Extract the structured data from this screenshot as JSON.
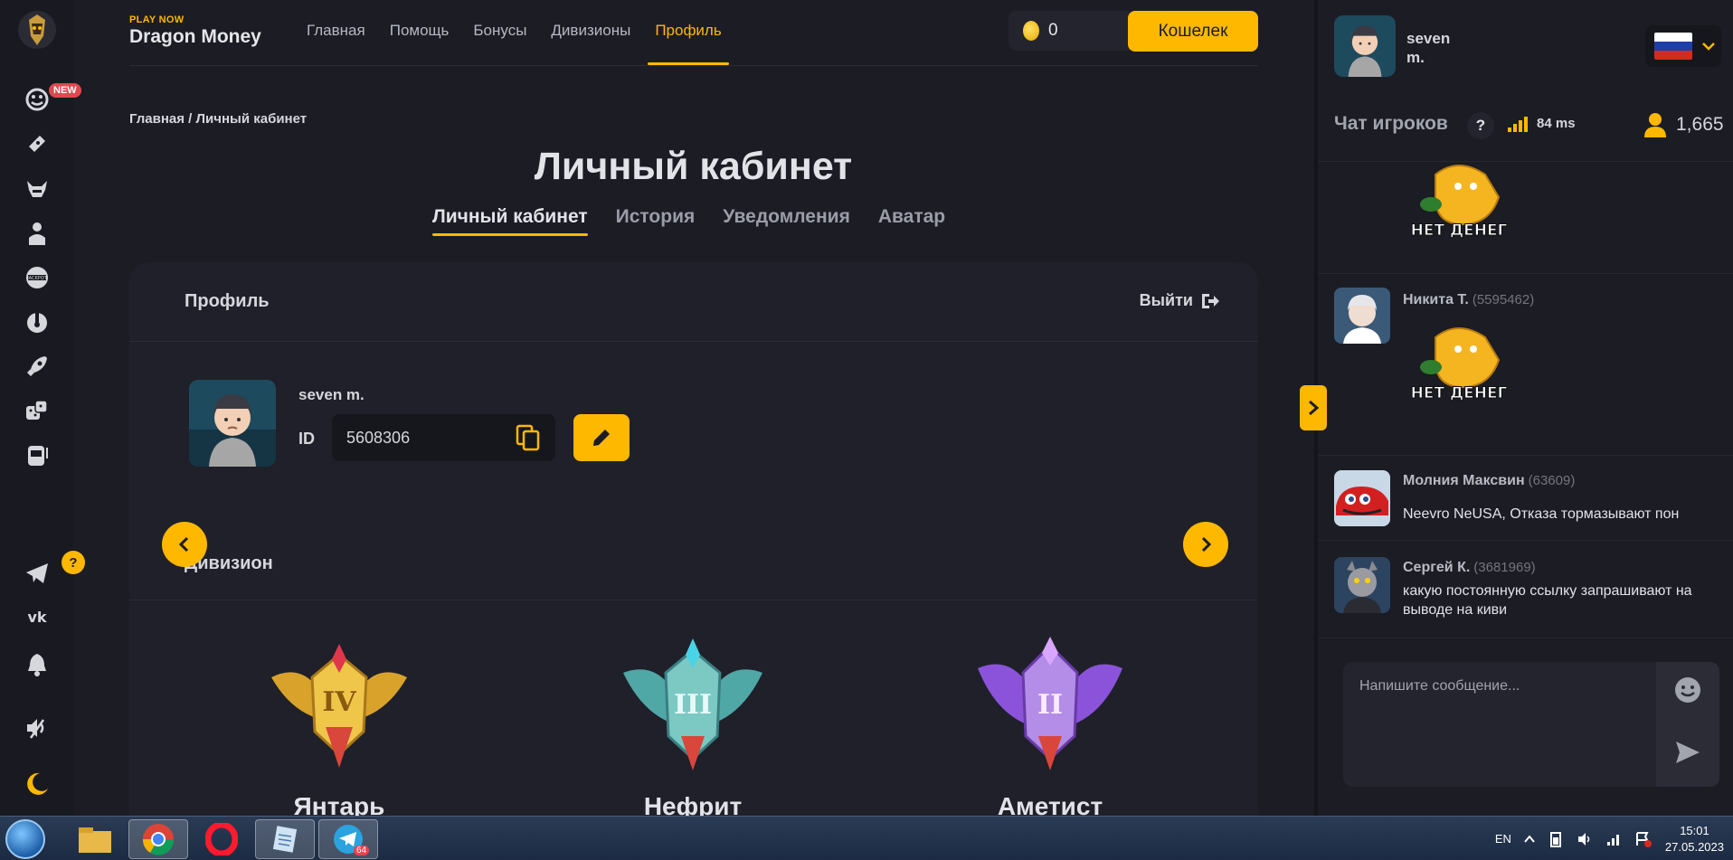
{
  "brand": {
    "tagline": "PLAY NOW",
    "name": "Dragon Money"
  },
  "nav": [
    "Главная",
    "Помощь",
    "Бонусы",
    "Дивизионы",
    "Профиль"
  ],
  "nav_active": "Профиль",
  "balance": "0",
  "wallet_label": "Кошелек",
  "rail": {
    "new_badge": "NEW",
    "help_badge": "?"
  },
  "breadcrumb": "Главная / Личный кабинет",
  "page_title": "Личный кабинет",
  "tabs": [
    "Личный кабинет",
    "История",
    "Уведомления",
    "Аватар"
  ],
  "profile": {
    "heading": "Профиль",
    "logout_label": "Выйти",
    "username": "seven m.",
    "id_label": "ID",
    "id_value": "5608306"
  },
  "division": {
    "heading": "Дивизион",
    "tiers": [
      "Янтарь",
      "Нефрит",
      "Аметист"
    ]
  },
  "chat": {
    "user_name_line1": "seven",
    "user_name_line2": "m.",
    "title": "Чат игроков",
    "help": "?",
    "ping": "84 ms",
    "online": "1,665",
    "sticker_text": "НЕТ ДЕНЕГ",
    "messages": [
      {
        "name": "Никита Т.",
        "uid": "(5595462)",
        "text": ""
      },
      {
        "name": "Молния Максвин",
        "uid": "(63609)",
        "text": "Neevro NeUSA, Отказа тормазывают пон"
      },
      {
        "name": "Сергей К.",
        "uid": "(3681969)",
        "text": "какую постоянную ссылку запрашивают на выводе на киви"
      }
    ],
    "input_placeholder": "Напишите сообщение..."
  },
  "taskbar": {
    "lang": "EN",
    "time": "15:01",
    "date": "27.05.2023",
    "telegram_count": "64"
  },
  "colors": {
    "accent": "#ffb800",
    "background": "#1b1c24",
    "card": "#1f2029"
  }
}
